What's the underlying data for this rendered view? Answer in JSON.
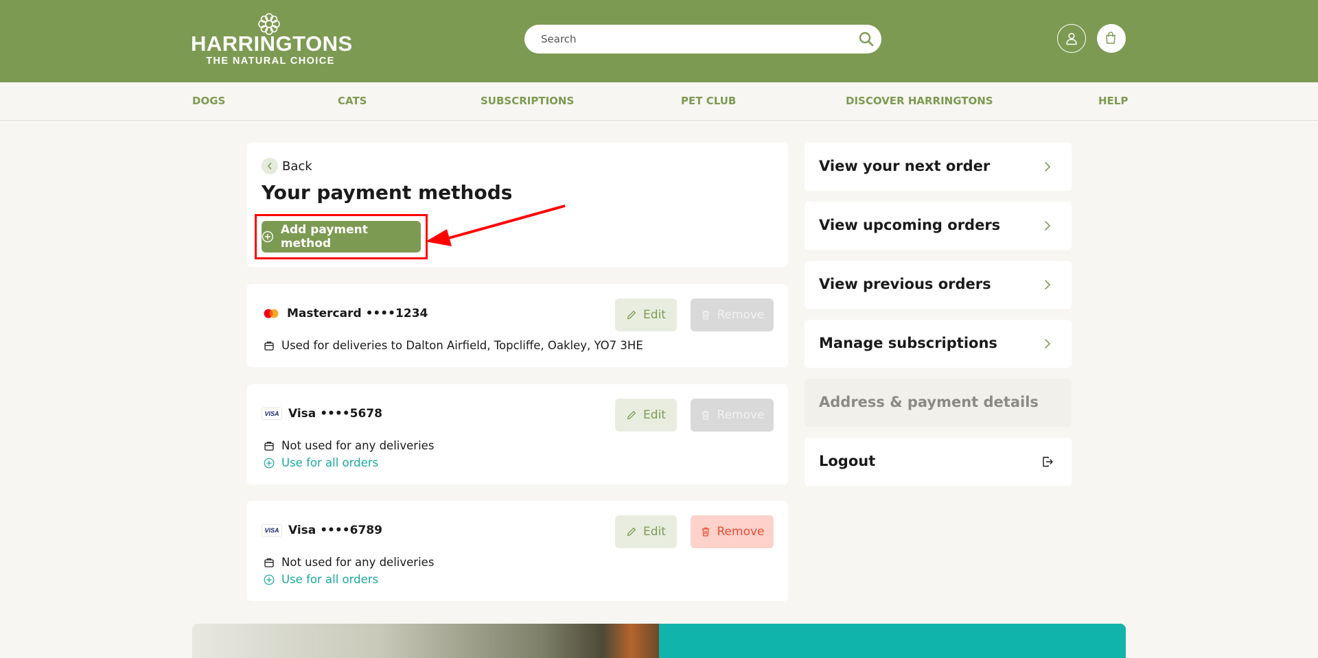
{
  "brand": {
    "name": "HARRINGTONS",
    "tagline": "THE NATURAL CHOICE",
    "color": "#7d9a52"
  },
  "header": {
    "search_placeholder": "Search",
    "icons": [
      "search-icon",
      "account-icon",
      "basket-icon"
    ]
  },
  "nav": {
    "items": [
      "DOGS",
      "CATS",
      "SUBSCRIPTIONS",
      "PET CLUB",
      "DISCOVER HARRINGTONS",
      "HELP"
    ]
  },
  "main": {
    "back_label": "Back",
    "title": "Your payment methods",
    "add_button_label": "Add payment method",
    "cards": [
      {
        "brand_icon": "mastercard-icon",
        "name": "Mastercard ••••1234",
        "usage": "Used for deliveries to Dalton Airfield, Topcliffe, Oakley, YO7 3HE",
        "edit_label": "Edit",
        "remove_label": "Remove",
        "remove_enabled": false
      },
      {
        "brand_icon": "visa-icon",
        "brand_text": "VISA",
        "name": "Visa ••••5678",
        "usage": "Not used for any deliveries",
        "use_all_label": "Use for all orders",
        "edit_label": "Edit",
        "remove_label": "Remove",
        "remove_enabled": false
      },
      {
        "brand_icon": "visa-icon",
        "brand_text": "VISA",
        "name": "Visa ••••6789",
        "usage": "Not used for any deliveries",
        "use_all_label": "Use for all orders",
        "edit_label": "Edit",
        "remove_label": "Remove",
        "remove_enabled": true
      }
    ]
  },
  "sidebar": {
    "items": [
      {
        "label": "View your next order",
        "icon": "chevron-right-icon"
      },
      {
        "label": "View upcoming orders",
        "icon": "chevron-right-icon"
      },
      {
        "label": "View previous orders",
        "icon": "chevron-right-icon"
      },
      {
        "label": "Manage subscriptions",
        "icon": "chevron-right-icon"
      },
      {
        "label": "Address & payment details",
        "current": true
      },
      {
        "label": "Logout",
        "icon": "logout-icon"
      }
    ]
  },
  "colors": {
    "accent_teal": "#1aa7a0",
    "remove_red": "#e94b35",
    "annotation_red": "#ff0000"
  }
}
